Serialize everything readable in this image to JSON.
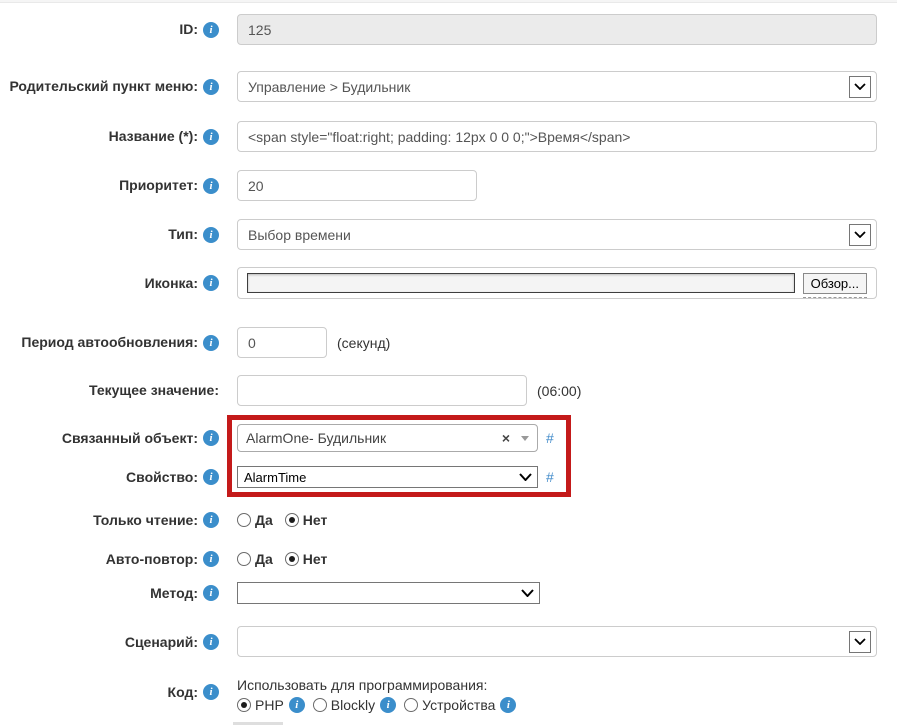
{
  "colors": {
    "accent_blue": "#3b8ecb",
    "highlight_red": "#c41a1a",
    "link_blue": "#428bca",
    "disabled_bg": "#ebebeb"
  },
  "icons": {
    "info": "i",
    "clear": "×",
    "chevron_down": "v",
    "dropdown_triangle": "▾"
  },
  "form": {
    "id": {
      "label": "ID:",
      "value": "125"
    },
    "parent_menu": {
      "label": "Родительский пункт меню:",
      "value": "Управление > Будильник"
    },
    "name": {
      "label": "Название (*):",
      "value": "<span style=\"float:right; padding: 12px 0 0 0;\">Время</span>"
    },
    "priority": {
      "label": "Приоритет:",
      "value": "20"
    },
    "type": {
      "label": "Тип:",
      "value": "Выбор времени"
    },
    "icon": {
      "label": "Иконка:",
      "value": "",
      "browse_label": "Обзор..."
    },
    "refresh_period": {
      "label": "Период автообновления:",
      "value": "0",
      "hint": "(секунд)"
    },
    "current_value": {
      "label": "Текущее значение:",
      "value": "",
      "hint": "(06:00)"
    },
    "linked_object": {
      "label": "Связанный объект:",
      "value": "AlarmOne- Будильник",
      "clear": "×",
      "hash": "#"
    },
    "property": {
      "label": "Свойство:",
      "value": "AlarmTime",
      "hash": "#"
    },
    "read_only": {
      "label": "Только чтение:",
      "yes": "Да",
      "no": "Нет",
      "selected": "Нет"
    },
    "auto_repeat": {
      "label": "Авто-повтор:",
      "yes": "Да",
      "no": "Нет",
      "selected": "Нет"
    },
    "method": {
      "label": "Метод:",
      "value": ""
    },
    "scenario": {
      "label": "Сценарий:",
      "value": ""
    },
    "code": {
      "label": "Код:",
      "prompt": "Использовать для программирования:",
      "options": [
        {
          "label": "PHP",
          "selected": true
        },
        {
          "label": "Blockly",
          "selected": false
        },
        {
          "label": "Устройства",
          "selected": false
        }
      ]
    }
  }
}
